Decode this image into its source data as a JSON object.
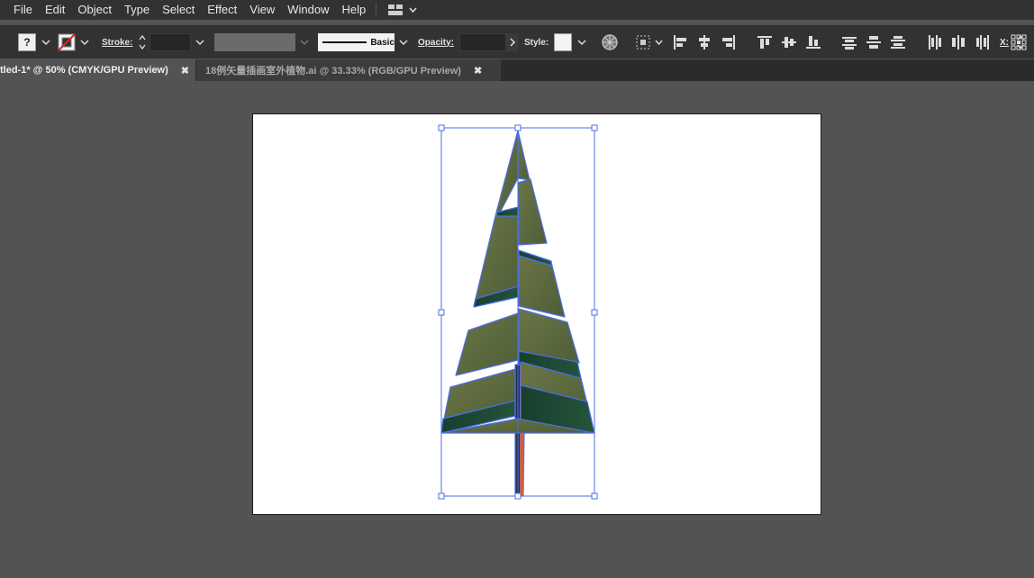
{
  "menu": {
    "items": [
      "File",
      "Edit",
      "Object",
      "Type",
      "Select",
      "Effect",
      "View",
      "Window",
      "Help"
    ]
  },
  "controlbar": {
    "fill_value": "?",
    "stroke_label": "Stroke:",
    "brush_label": "Basic",
    "opacity_label": "Opacity:",
    "style_label": "Style:",
    "x_label": "X:"
  },
  "tabs": [
    {
      "label": "tled-1* @ 50% (CMYK/GPU Preview)",
      "close": "✖",
      "active": true
    },
    {
      "label": "18例矢量插画室外植物.ai @ 33.33% (RGB/GPU Preview)",
      "close": "✖",
      "active": false
    }
  ],
  "colors": {
    "selection": "#4a6fe8",
    "tree_light": "#5c6a3e",
    "tree_dark": "#1e4a36",
    "trunk": "#c8604a"
  }
}
